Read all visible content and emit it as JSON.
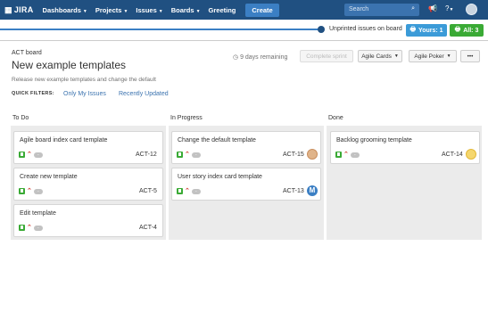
{
  "nav": {
    "logo": "JIRA",
    "items": [
      {
        "label": "Dashboards"
      },
      {
        "label": "Projects"
      },
      {
        "label": "Issues"
      },
      {
        "label": "Boards"
      },
      {
        "label": "Greeting"
      }
    ],
    "create_label": "Create",
    "search_placeholder": "Search"
  },
  "notice": {
    "text": "Unprinted issues on board",
    "yours_label": "Yours: 1",
    "all_label": "All: 3"
  },
  "header": {
    "board_label": "ACT board",
    "title": "New example templates",
    "subtitle": "Release new example templates and change the default",
    "quick_filters_label": "QUICK FILTERS:",
    "quick_filters": [
      "Only My Issues",
      "Recently Updated"
    ],
    "days_remaining": "9 days remaining",
    "complete_sprint": "Complete sprint",
    "agile_cards": "Agile Cards",
    "agile_poker": "Agile Poker",
    "more": "•••"
  },
  "columns": [
    {
      "title": "To Do",
      "cards": [
        {
          "title": "Agile board index card template",
          "key": "ACT-12",
          "estimate": "-"
        },
        {
          "title": "Create new template",
          "key": "ACT-5",
          "estimate": "-"
        },
        {
          "title": "Edit template",
          "key": "ACT-4",
          "estimate": "-"
        }
      ]
    },
    {
      "title": "In Progress",
      "cards": [
        {
          "title": "Change the default template",
          "key": "ACT-15",
          "estimate": "-"
        },
        {
          "title": "User story index card template",
          "key": "ACT-13",
          "estimate": "-",
          "avatar_letter": "M"
        }
      ]
    },
    {
      "title": "Done",
      "cards": [
        {
          "title": "Backlog grooming template",
          "key": "ACT-14",
          "estimate": "-"
        }
      ]
    }
  ],
  "colors": {
    "nav_bg": "#205081",
    "accent": "#3b73af",
    "story_green": "#3aaa35",
    "priority_red": "#d04437"
  }
}
